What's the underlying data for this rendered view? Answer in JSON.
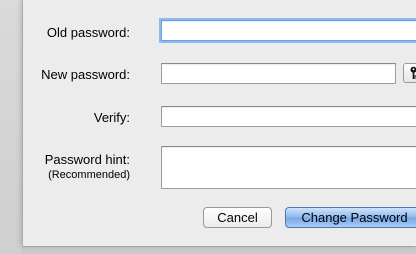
{
  "form": {
    "old_password_label": "Old password:",
    "new_password_label": "New password:",
    "verify_label": "Verify:",
    "hint_label": "Password hint:",
    "hint_sublabel": "(Recommended)",
    "old_password_value": "",
    "new_password_value": "",
    "verify_value": "",
    "hint_value": "",
    "key_icon": "key-icon"
  },
  "buttons": {
    "cancel": "Cancel",
    "change_password": "Change Password"
  },
  "colors": {
    "focus_ring": "#8fbaf0",
    "primary_button": "#8cb8ee"
  }
}
